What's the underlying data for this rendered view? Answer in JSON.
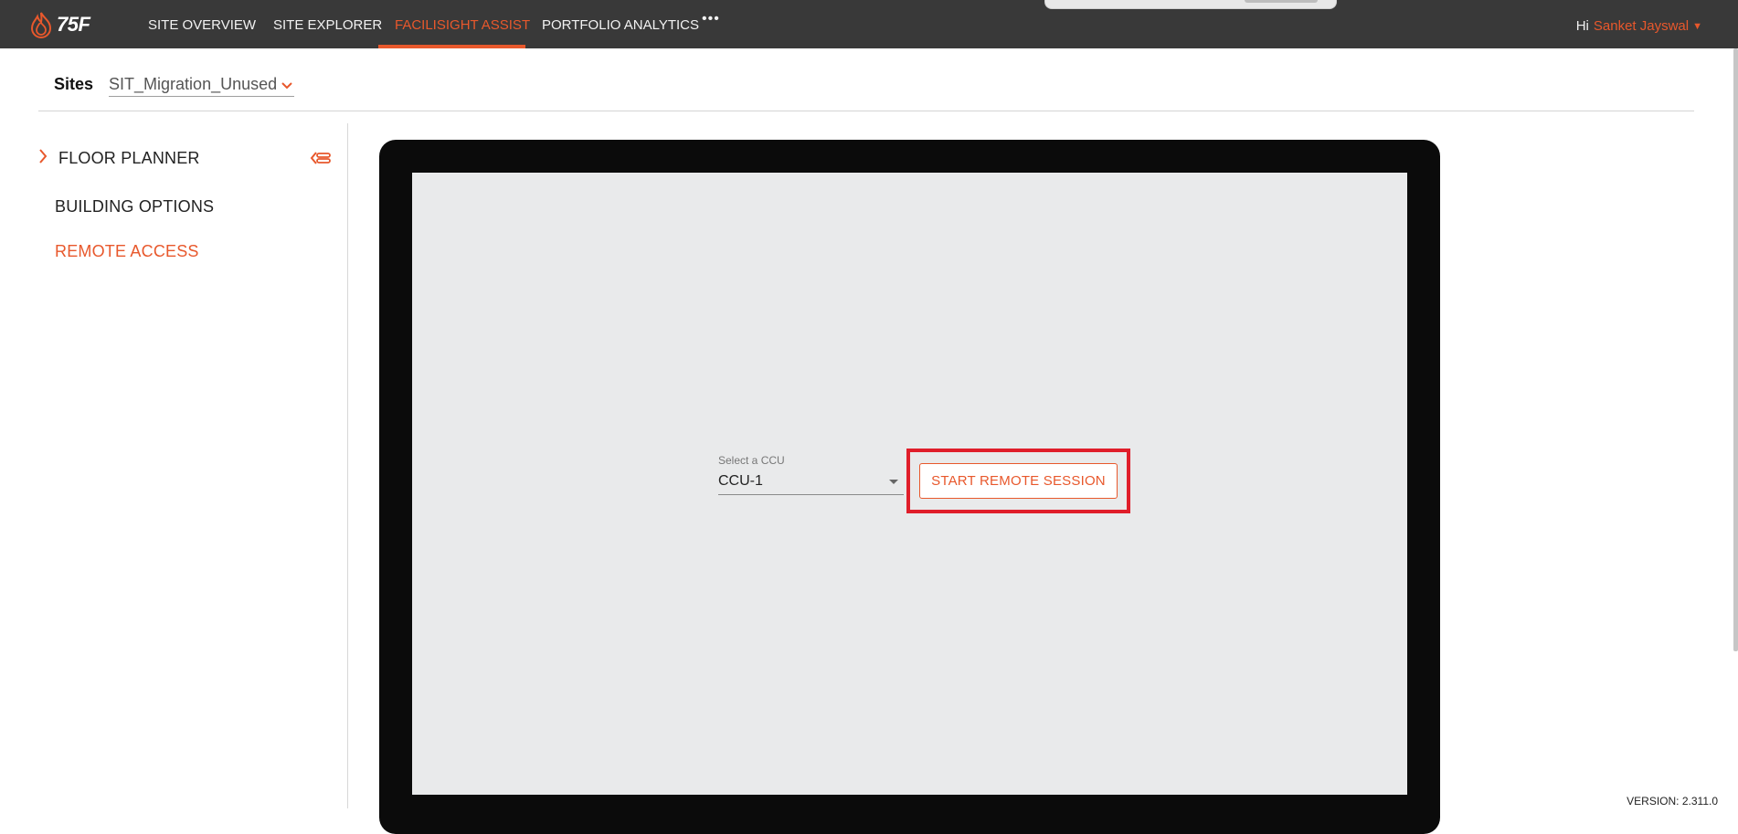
{
  "topnav": {
    "logo_text": "75F",
    "items": [
      {
        "label": "SITE OVERVIEW"
      },
      {
        "label": "SITE EXPLORER"
      },
      {
        "label": "FACILISIGHT ASSIST"
      },
      {
        "label": "PORTFOLIO ANALYTICS"
      }
    ],
    "active_index": 2,
    "more_label": "•••",
    "greeting_prefix": "Hi",
    "user_name": "Sanket Jayswal"
  },
  "sites": {
    "label": "Sites",
    "selected": "SIT_Migration_Unused"
  },
  "sidebar": {
    "items": [
      {
        "label": "FLOOR PLANNER"
      },
      {
        "label": "BUILDING OPTIONS"
      },
      {
        "label": "REMOTE ACCESS"
      }
    ]
  },
  "remote": {
    "ccu_label": "Select a CCU",
    "ccu_value": "CCU-1",
    "start_button": "START REMOTE SESSION"
  },
  "footer": {
    "version": "VERSION: 2.311.0"
  },
  "colors": {
    "accent": "#e8582c",
    "nav_bg": "#393939",
    "highlight": "#e01e2a"
  }
}
